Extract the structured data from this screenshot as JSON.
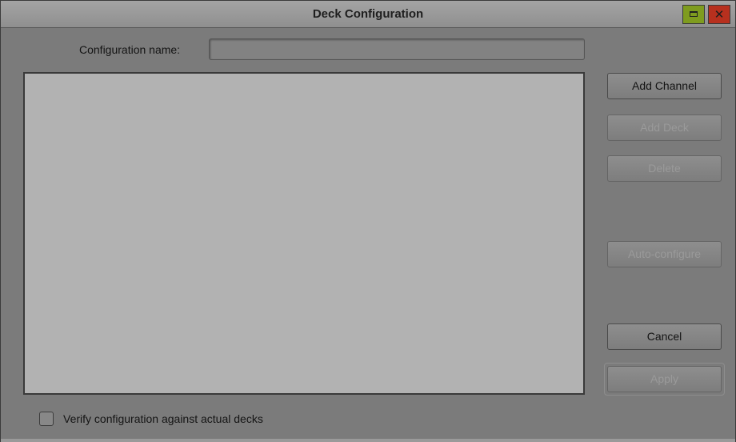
{
  "window": {
    "title": "Deck Configuration"
  },
  "form": {
    "configuration_name_label": "Configuration name:",
    "configuration_name_value": ""
  },
  "buttons": {
    "add_channel": "Add Channel",
    "add_deck": "Add Deck",
    "delete": "Delete",
    "auto_configure": "Auto-configure",
    "cancel": "Cancel",
    "apply": "Apply"
  },
  "options": {
    "verify_label": "Verify configuration against actual decks",
    "verify_checked": false
  },
  "icons": {
    "maximize": "maximize-icon",
    "close": "close-icon"
  },
  "colors": {
    "window_bg": "#7b7b7b",
    "list_bg": "#b2b2b2",
    "maximize_btn": "#7f9c1f",
    "close_btn": "#b7301e"
  }
}
